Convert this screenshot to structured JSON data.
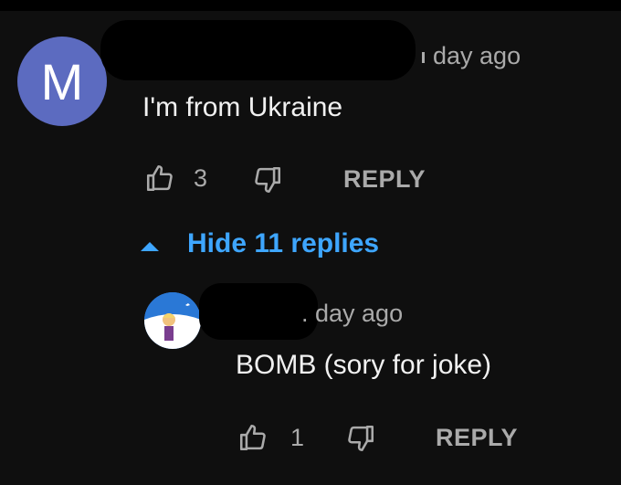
{
  "comment": {
    "avatar_letter": "M",
    "time": "day ago",
    "text": "I'm from  Ukraine",
    "likes": "3",
    "reply_label": "REPLY"
  },
  "replies_toggle": {
    "label": "Hide 11 replies"
  },
  "reply": {
    "time": ". day ago",
    "text": "BOMB (sory for joke)",
    "likes": "1",
    "reply_label": "REPLY"
  },
  "colors": {
    "background": "#0f0f0f",
    "avatar_m": "#5c6bc0",
    "link_blue": "#3ea6ff",
    "secondary_text": "#aaaaaa",
    "primary_text": "#f1f1f1"
  },
  "icons": {
    "like": "thumbs-up-outline",
    "dislike": "thumbs-down-outline",
    "toggle": "caret-up"
  }
}
